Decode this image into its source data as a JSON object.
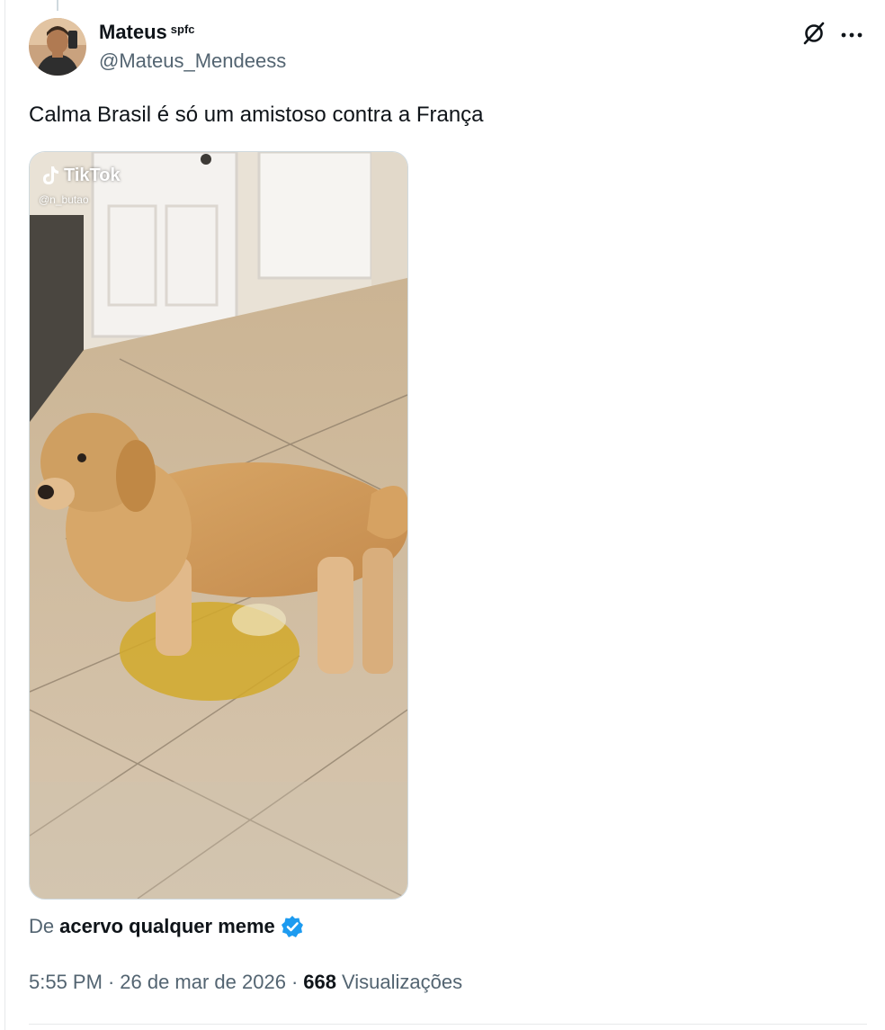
{
  "author": {
    "display_name": "Mateus",
    "name_suffix": "spfc",
    "handle": "@Mateus_Mendeess"
  },
  "icons": {
    "grok": "grok-slash-icon",
    "more": "more-dots-icon",
    "tiktok": "tiktok-logo-icon",
    "verified": "verified-badge-icon"
  },
  "tweet": {
    "text": "Calma Brasil é só um amistoso contra a França"
  },
  "media": {
    "watermark_brand": "TikTok",
    "watermark_user": "@n_butao"
  },
  "source": {
    "prefix": "De",
    "account": "acervo qualquer meme"
  },
  "meta": {
    "time": "5:55 PM",
    "separator": "·",
    "date": "26 de mar de 2026",
    "views_count": "668",
    "views_label": "Visualizações"
  },
  "colors": {
    "text_primary": "#0f1419",
    "text_secondary": "#536471",
    "verified_blue": "#1d9bf0",
    "border": "#e7e9ea"
  }
}
